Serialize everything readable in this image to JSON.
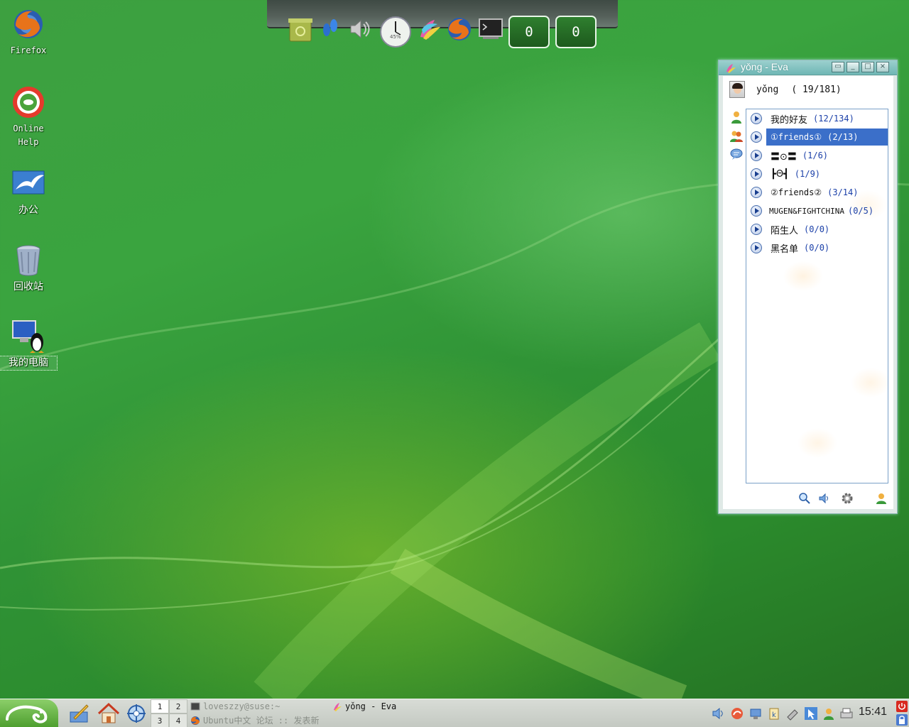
{
  "desktop": {
    "icons": [
      {
        "label": "Firefox"
      },
      {
        "label": "Online\nHelp"
      },
      {
        "label": "办公"
      },
      {
        "label": "回收站"
      },
      {
        "label": "我的电脑"
      }
    ]
  },
  "dock": {
    "counters": [
      "0",
      "0"
    ],
    "clock_label": "45%"
  },
  "eva": {
    "title": "yǒng - Eva",
    "user": {
      "name": "yǒng",
      "count": "( 19/181)"
    },
    "groups": [
      {
        "name": "我的好友",
        "count": "(12/134)",
        "selected": false
      },
      {
        "name": "①friends①",
        "count": "(2/13)",
        "selected": true
      },
      {
        "name": "〓⊙〓",
        "count": "(1/6)",
        "selected": false
      },
      {
        "name": "┣Θ┫",
        "count": "(1/9)",
        "selected": false
      },
      {
        "name": "②friends②",
        "count": "(3/14)",
        "selected": false
      },
      {
        "name": "MUGEN&FIGHTCHINA",
        "count": "(0/5)",
        "selected": false
      },
      {
        "name": "陌生人",
        "count": "(0/0)",
        "selected": false
      },
      {
        "name": "黑名单",
        "count": "(0/0)",
        "selected": false
      }
    ]
  },
  "taskbar": {
    "pager": [
      "1",
      "2",
      "3",
      "4"
    ],
    "tasks": [
      {
        "label": "loveszzy@suse:~"
      },
      {
        "label": "yǒng - Eva"
      },
      {
        "label": "Ubuntu中文 论坛 :: 发表新"
      }
    ],
    "clock": "15:41"
  },
  "colors": {
    "selection": "#3b6fc9",
    "count_text": "#1a3fa8",
    "eva_title": "#6fb7b5"
  }
}
